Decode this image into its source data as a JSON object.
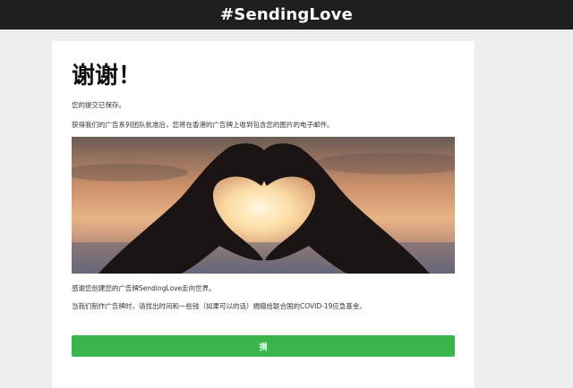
{
  "header": {
    "brand": "#SendingLove"
  },
  "confirmation": {
    "title": "谢谢！",
    "saved_message": "您的提交已保存。",
    "approval_message": "获得我们的广告系列团队批准后，您将在香港的广告牌上收到包含您的图片的电子邮件。",
    "thanks_message": "感谢您创建您的广告牌SendingLove走向世界。",
    "donate_prompt": "当我们制作广告牌时，请找出时间和一些钱（如果可以的话）捐赠给联合国的COVID-19应急基金。"
  },
  "donate_button": {
    "label": "捐"
  },
  "colors": {
    "topbar": "#1e1e1e",
    "button": "#3ab54a",
    "page_background": "#eeeeee"
  }
}
